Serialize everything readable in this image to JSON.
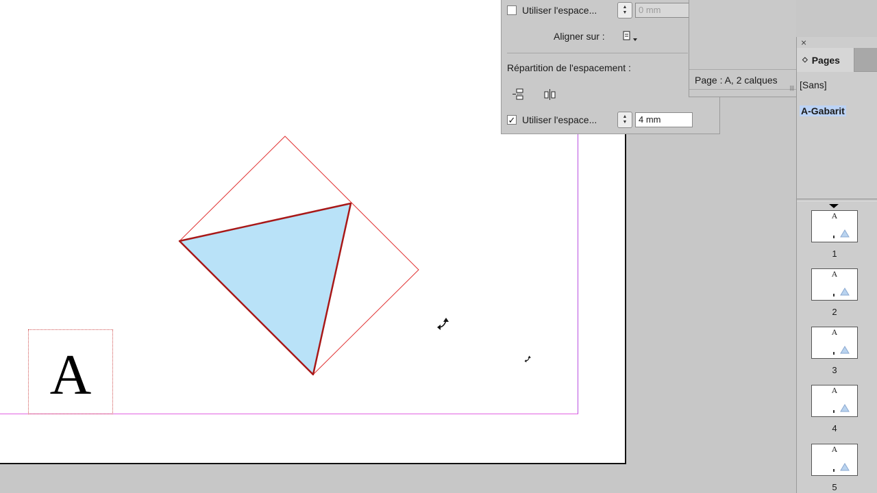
{
  "alignment_panel": {
    "use_spacing_top_label": "Utiliser l'espace...",
    "use_spacing_top_value": "0 mm",
    "use_spacing_top_checked": false,
    "align_on_label": "Aligner sur :",
    "distribution_heading": "Répartition de l'espacement :",
    "use_spacing_bottom_label": "Utiliser l'espace...",
    "use_spacing_bottom_value": "4 mm",
    "use_spacing_bottom_checked": true
  },
  "info_panel": {
    "status_text": "Page : A, 2 calques"
  },
  "pages_panel": {
    "tab_label": "Pages",
    "none_master": "[Sans]",
    "master_name": "A-Gabarit",
    "pages": [
      {
        "number": "1",
        "master_letter": "A"
      },
      {
        "number": "2",
        "master_letter": "A"
      },
      {
        "number": "3",
        "master_letter": "A"
      },
      {
        "number": "4",
        "master_letter": "A"
      },
      {
        "number": "5",
        "master_letter": "A"
      }
    ]
  },
  "document": {
    "master_letter": "A",
    "triangle_fill": "#b9e2f8",
    "selection_color": "#d02020"
  }
}
